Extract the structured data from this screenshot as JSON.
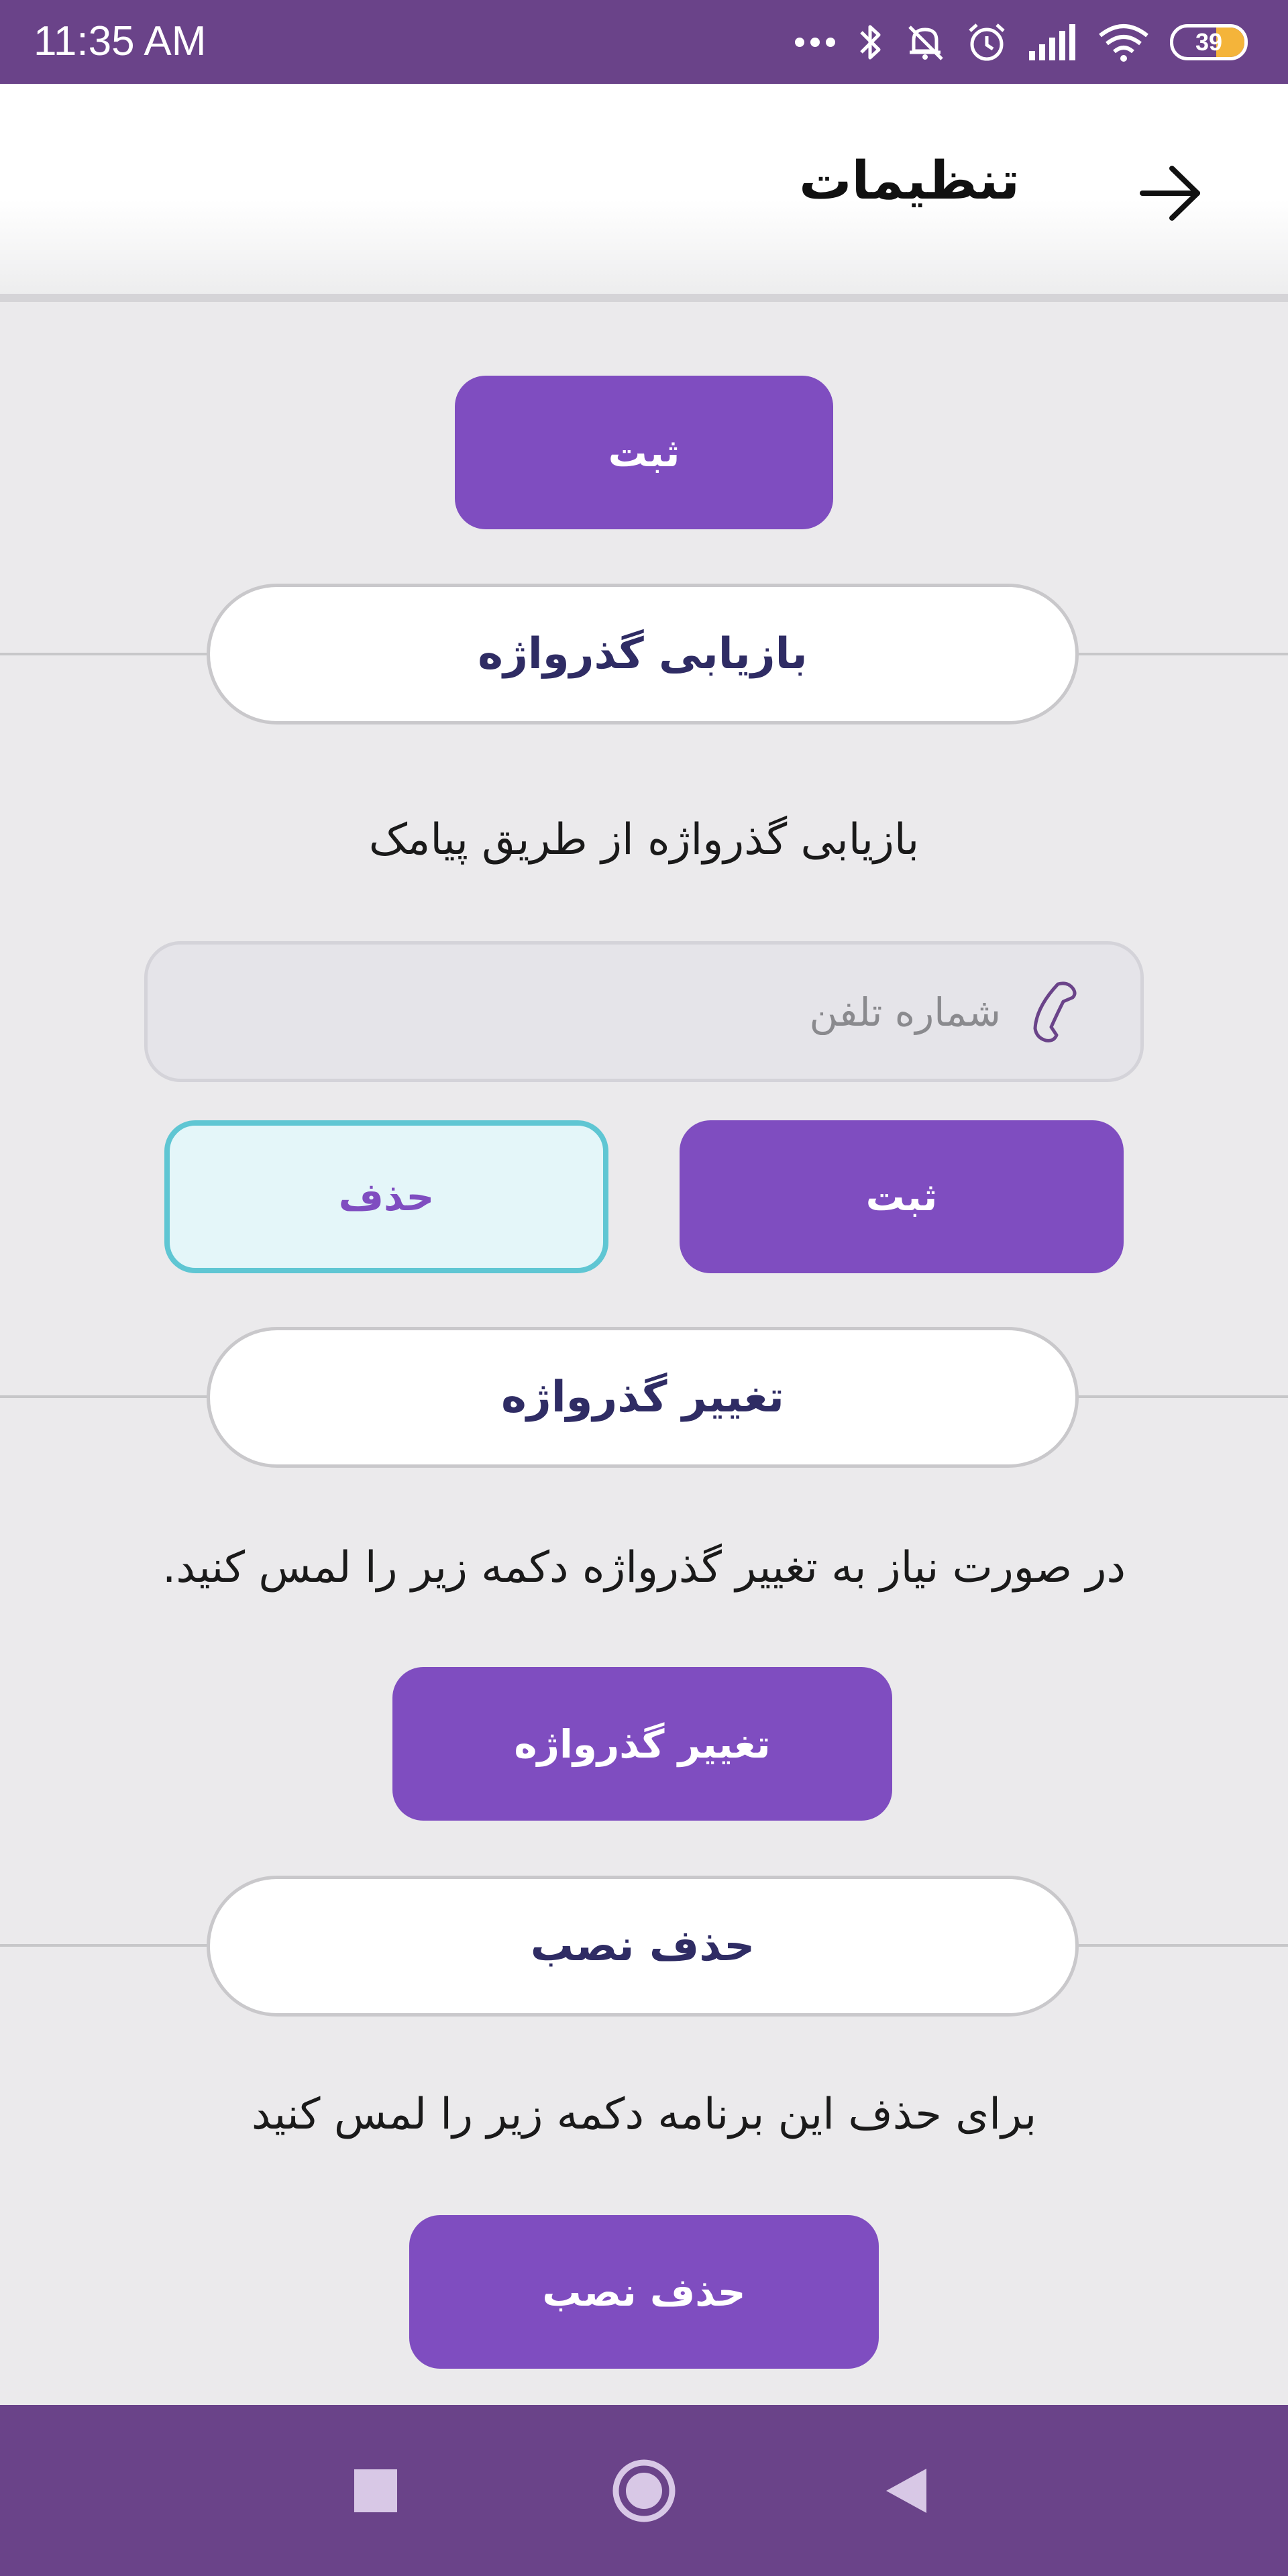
{
  "status_bar": {
    "time": "11:35 AM",
    "battery": "39",
    "icons": [
      "more-dots-icon",
      "bluetooth-icon",
      "mute-icon",
      "alarm-icon",
      "signal-icon",
      "wifi-icon",
      "battery-icon"
    ]
  },
  "app_bar": {
    "title": "تنظیمات",
    "back_icon": "arrow-right-icon"
  },
  "top_submit_label": "ثبت",
  "password_recovery": {
    "header": "بازیابی گذرواژه",
    "description": "بازیابی گذرواژه از طریق پیامک",
    "phone_placeholder": "شماره تلفن",
    "phone_value": "",
    "phone_icon": "phone-icon",
    "submit_label": "ثبت",
    "delete_label": "حذف"
  },
  "change_password": {
    "header": "تغییر گذرواژه",
    "description": "در صورت نیاز به تغییر گذرواژه دکمه زیر را لمس کنید.",
    "button_label": "تغییر گذرواژه"
  },
  "uninstall": {
    "header": "حذف نصب",
    "description": "برای حذف این برنامه دکمه زیر را لمس کنید",
    "button_label": "حذف نصب"
  },
  "nav_bar": {
    "icons": [
      "square-recents-icon",
      "circle-home-icon",
      "triangle-back-icon"
    ]
  },
  "colors": {
    "status_bar": "#6a4389",
    "primary_button": "#7f4dc0",
    "outline_border": "#5fc6d3",
    "outline_bg": "#e4f6f9",
    "section_text": "#2f2c64",
    "background": "#ebeaec",
    "battery_fill": "#f4b43a"
  }
}
